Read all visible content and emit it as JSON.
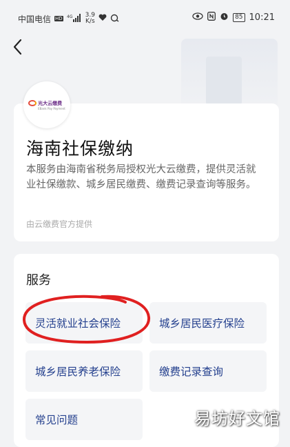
{
  "status_bar": {
    "carrier": "中国电信",
    "hd": "HD",
    "network": "4G",
    "speed_value": "3.9",
    "speed_unit": "K/s",
    "battery": "85",
    "time": "10:21"
  },
  "nav": {
    "back_icon": "chevron-left-icon",
    "more_icon": "more-dots-icon"
  },
  "service": {
    "logo_text": "光大云缴费",
    "logo_subtext": "EBank Pay Payment",
    "title": "海南社保缴纳",
    "description": "本服务由海南省税务局授权光大云缴费，提供灵活就业社保缴款、城乡居民缴费、缴费记录查询等服务。",
    "provider": "由云缴费官方提供"
  },
  "services_section": {
    "heading": "服务",
    "items": [
      {
        "label": "灵活就业社会保险"
      },
      {
        "label": "城乡居民医疗保险"
      },
      {
        "label": "城乡居民养老保险"
      },
      {
        "label": "缴费记录查询"
      },
      {
        "label": "常见问题"
      }
    ]
  },
  "annotation": {
    "color": "#e02020"
  },
  "watermark": "易坊好文馆",
  "colors": {
    "accent_text": "#24408e",
    "background": "#f2f3f5",
    "annotation_red": "#e02020"
  }
}
